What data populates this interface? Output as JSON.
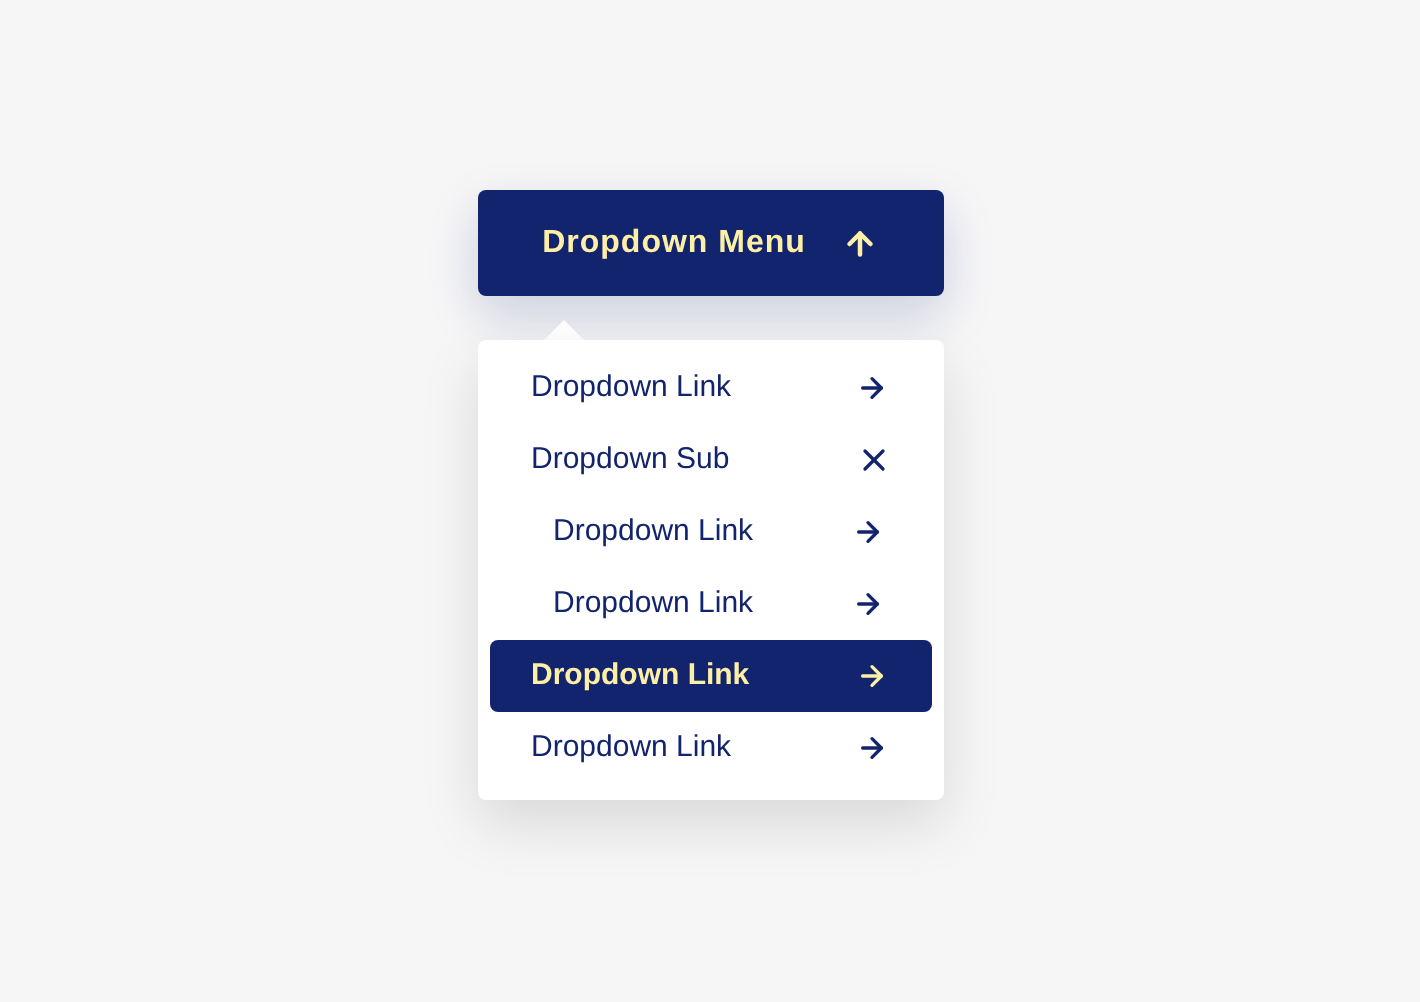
{
  "menu_button": {
    "label": "Dropdown Menu",
    "expanded": true
  },
  "items": [
    {
      "label": "Dropdown Link",
      "kind": "link",
      "selected": false
    },
    {
      "label": "Dropdown Sub",
      "kind": "sub",
      "expanded": true,
      "children": [
        {
          "label": "Dropdown Link",
          "kind": "link",
          "selected": false
        },
        {
          "label": "Dropdown Link",
          "kind": "link",
          "selected": false
        }
      ]
    },
    {
      "label": "Dropdown Link",
      "kind": "link",
      "selected": true
    },
    {
      "label": "Dropdown Link",
      "kind": "link",
      "selected": false
    }
  ]
}
